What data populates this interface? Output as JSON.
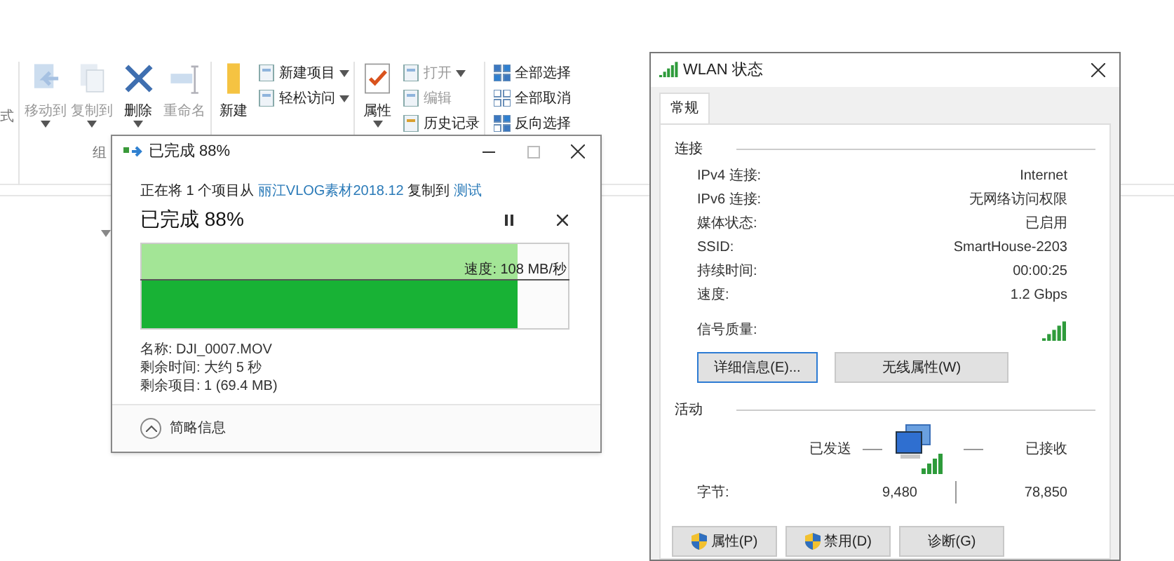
{
  "ribbon": {
    "cut_label": "式",
    "groups": [
      {
        "label": "组",
        "large": [
          {
            "label": "移动到",
            "disabled": true,
            "dropdown": true
          },
          {
            "label": "复制到",
            "disabled": true,
            "dropdown": true
          },
          {
            "label": "删除",
            "disabled": false,
            "dropdown": true
          },
          {
            "label": "重命名",
            "disabled": true,
            "dropdown": false
          }
        ]
      },
      {
        "large": [
          {
            "label": "新建",
            "disabled": false,
            "dropdown": false
          }
        ],
        "small": [
          {
            "label": "新建项目",
            "disabled": false,
            "dropdown": true
          },
          {
            "label": "轻松访问",
            "disabled": false,
            "dropdown": true
          }
        ]
      },
      {
        "large": [
          {
            "label": "属性",
            "disabled": false,
            "dropdown": true
          }
        ],
        "small": [
          {
            "label": "打开",
            "disabled": true,
            "dropdown": true
          },
          {
            "label": "编辑",
            "disabled": true,
            "dropdown": false
          },
          {
            "label": "历史记录",
            "disabled": false,
            "dropdown": false
          }
        ]
      },
      {
        "small": [
          {
            "label": "全部选择",
            "disabled": false,
            "dropdown": false
          },
          {
            "label": "全部取消",
            "disabled": false,
            "dropdown": false
          },
          {
            "label": "反向选择",
            "disabled": false,
            "dropdown": false
          }
        ]
      }
    ]
  },
  "copy_dialog": {
    "title": "已完成 88%",
    "message": {
      "prefix": "正在将 1 个项目从",
      "source": "丽江VLOG素材2018.12",
      "middle": "复制到",
      "destination": "测试"
    },
    "heading": "已完成 88%",
    "progress": {
      "level": 0.88,
      "speed": "速度: 108 MB/秒"
    },
    "details": [
      "名称: DJI_0007.MOV",
      "剩余时间: 大约 5 秒",
      "剩余项目: 1 (69.4 MB)"
    ],
    "footer": "简略信息"
  },
  "wlan_dialog": {
    "title": "WLAN 状态",
    "tabs": [
      {
        "label": "常规",
        "selected": true
      }
    ],
    "connection": {
      "label": "连接",
      "rows": [
        {
          "label": "IPv4 连接:",
          "value": "Internet"
        },
        {
          "label": "IPv6 连接:",
          "value": "无网络访问权限"
        },
        {
          "label": "媒体状态:",
          "value": "已启用"
        },
        {
          "label": "SSID:",
          "value": "SmartHouse-2203"
        },
        {
          "label": "持续时间:",
          "value": "00:00:25"
        },
        {
          "label": "速度:",
          "value": "1.2 Gbps"
        }
      ],
      "signal_label": "信号质量:"
    },
    "buttons": [
      {
        "label": "详细信息(E)...",
        "focused": true
      },
      {
        "label": "无线属性(W)",
        "focused": false
      }
    ],
    "activity": {
      "label": "活动",
      "sent_label": "已发送",
      "received_label": "已接收",
      "bytes_label": "字节:",
      "sent": "9,480",
      "received": "78,850"
    },
    "bottom_buttons": [
      {
        "label": "属性(P)",
        "shield": true
      },
      {
        "label": "禁用(D)",
        "shield": true
      },
      {
        "label": "诊断(G)",
        "shield": false
      }
    ]
  }
}
